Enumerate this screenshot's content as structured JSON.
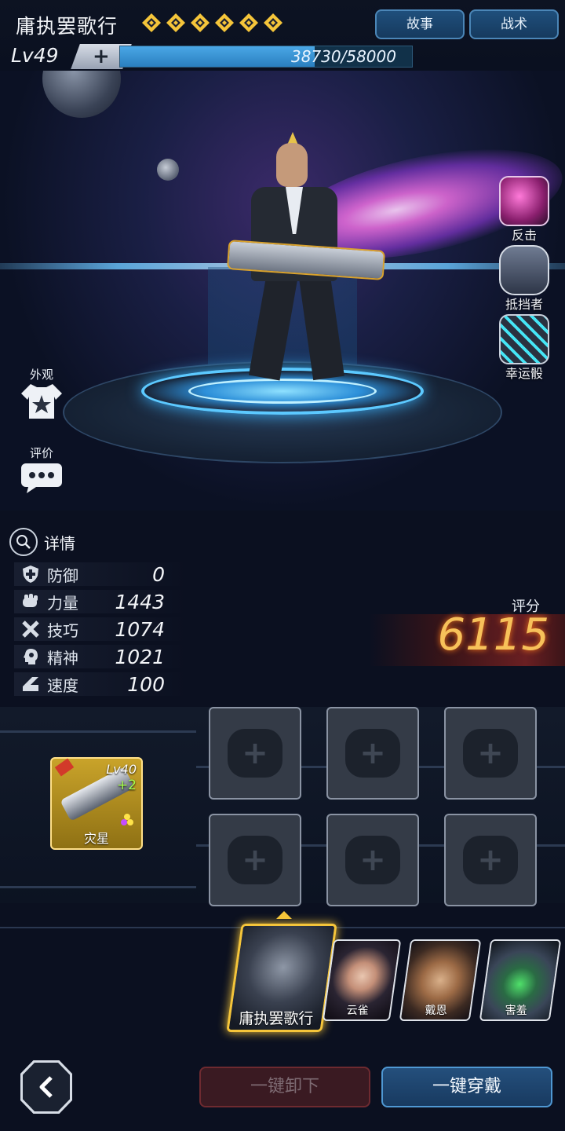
{
  "header": {
    "hero_name": "庸执罢歌行",
    "star_count": 6,
    "level_label": "Lv49",
    "plus_label": "+",
    "xp_text": "38730/58000",
    "xp_fraction": 0.6677,
    "story_button": "故事",
    "tactics_button": "战术"
  },
  "scene_skills": [
    {
      "label": "反击",
      "icon": "slash-skill-icon"
    },
    {
      "label": "抵挡者",
      "icon": "shield-skill-icon"
    },
    {
      "label": "幸运骰",
      "icon": "dice-skill-icon"
    }
  ],
  "left_actions": {
    "appearance_label": "外观",
    "review_label": "评价"
  },
  "details": {
    "title": "详情",
    "stats": [
      {
        "name": "防御",
        "value": "0",
        "icon": "defense-icon"
      },
      {
        "name": "力量",
        "value": "1443",
        "icon": "strength-icon"
      },
      {
        "name": "技巧",
        "value": "1074",
        "icon": "skill-icon"
      },
      {
        "name": "精神",
        "value": "1021",
        "icon": "spirit-icon"
      },
      {
        "name": "速度",
        "value": "100",
        "icon": "speed-icon"
      }
    ]
  },
  "score": {
    "label": "评分",
    "value": "6115"
  },
  "weapon": {
    "level": "Lv40",
    "plus": "+2",
    "name": "灾星"
  },
  "roster": [
    {
      "name": "庸执罢歌行",
      "selected": true
    },
    {
      "name": "云雀",
      "selected": false
    },
    {
      "name": "戴恩",
      "selected": false
    },
    {
      "name": "害羞",
      "selected": false
    }
  ],
  "buttons": {
    "unequip_all": "一键卸下",
    "equip_all": "一键穿戴"
  },
  "colors": {
    "gold": "#f5c53a",
    "score": "#f7c15a",
    "accent_blue": "#4aa7e6"
  }
}
